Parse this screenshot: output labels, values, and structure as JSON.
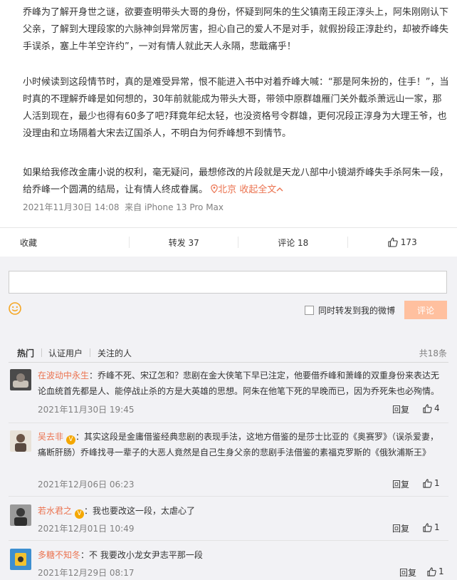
{
  "post": {
    "para1": "乔峰为了解开身世之谜，欲要查明带头大哥的身份，怀疑到阿朱的生父镇南王段正淳头上，阿朱刚刚认下父亲，了解到大理段家的六脉神剑异常厉害，担心自己的爱人不是对手，就假扮段正淳赴约，却被乔峰失手误杀，塞上牛羊空许约”，一对有情人就此天人永隔，悲戢痛乎！",
    "para2": "小时候读到这段情节时，真的是难受异常，恨不能进入书中对着乔峰大喊：“那是阿朱扮的，住手！”，当时真的不理解乔峰是如何想的，30年前就能成为带头大哥，带领中原群雄雁门关外截杀萧远山一家，那人活到现在，最少也得有60多了吧?拜竟年纪太轻，也没资格号令群雄，更何况段正淳身为大理王爷，也没理由和立场隔着大宋去辽国杀人，不明白为何乔峰想不到情节。",
    "para3": "如果给我修改金庸小说的权利，毫无疑问，最想修改的片段就是天龙八部中小镜湖乔峰失手杀阿朱一段，给乔峰一个圆满的结局，让有情人终成眷属。",
    "location": "北京",
    "collapse": "收起全文",
    "time": "2021年11月30日 14:08",
    "source": "来自 iPhone 13 Pro Max"
  },
  "actions": {
    "collect": "收藏",
    "forward": "转发 37",
    "comment": "评论 18",
    "like": "173"
  },
  "compose": {
    "forward_label": "同时转发到我的微博",
    "submit": "评论"
  },
  "tabs": {
    "hot": "热门",
    "verified": "认证用户",
    "following": "关注的人",
    "total": "共18条"
  },
  "comments": [
    {
      "user": "在波动中永生",
      "vip": false,
      "text": "：乔峰不死、宋辽怎和？悲剧在金大侠笔下早已注定，他要借乔峰和萧峰的双重身份来表达无论血统首先都是人、能停战止杀的方是大英雄的思想。阿朱在他笔下死的早晚而已，因为乔死朱也必殉情。",
      "time": "2021年11月30日 19:45",
      "reply": "回复",
      "likes": "4"
    },
    {
      "user": "吴去非",
      "vip": true,
      "text": "：其实这段是金庸借鉴经典悲剧的表现手法，这地方借鉴的是莎士比亚的《奥赛罗》（误杀爱妻，痛断肝肠）乔峰找寻一辈子的大恶人竟然是自己生身父亲的悲剧手法借鉴的素福克罗斯的《俄狄浦斯王》",
      "time": "2021年12月06日 06:23",
      "reply": "回复",
      "likes": "1"
    },
    {
      "user": "若水君之",
      "vip": true,
      "text": "：我也要改这一段，太虐心了",
      "time": "2021年12月01日 10:49",
      "reply": "回复",
      "likes": "1"
    },
    {
      "user": "多糖不知冬",
      "vip": false,
      "text": "：不 我要改小龙女尹志平那一段",
      "time": "2021年12月29日 08:17",
      "reply": "回复",
      "likes": "1"
    }
  ],
  "colors": {
    "link": "#eb7350",
    "submit_bg": "#ffc09f",
    "panel_bg": "#f2f2f5"
  }
}
